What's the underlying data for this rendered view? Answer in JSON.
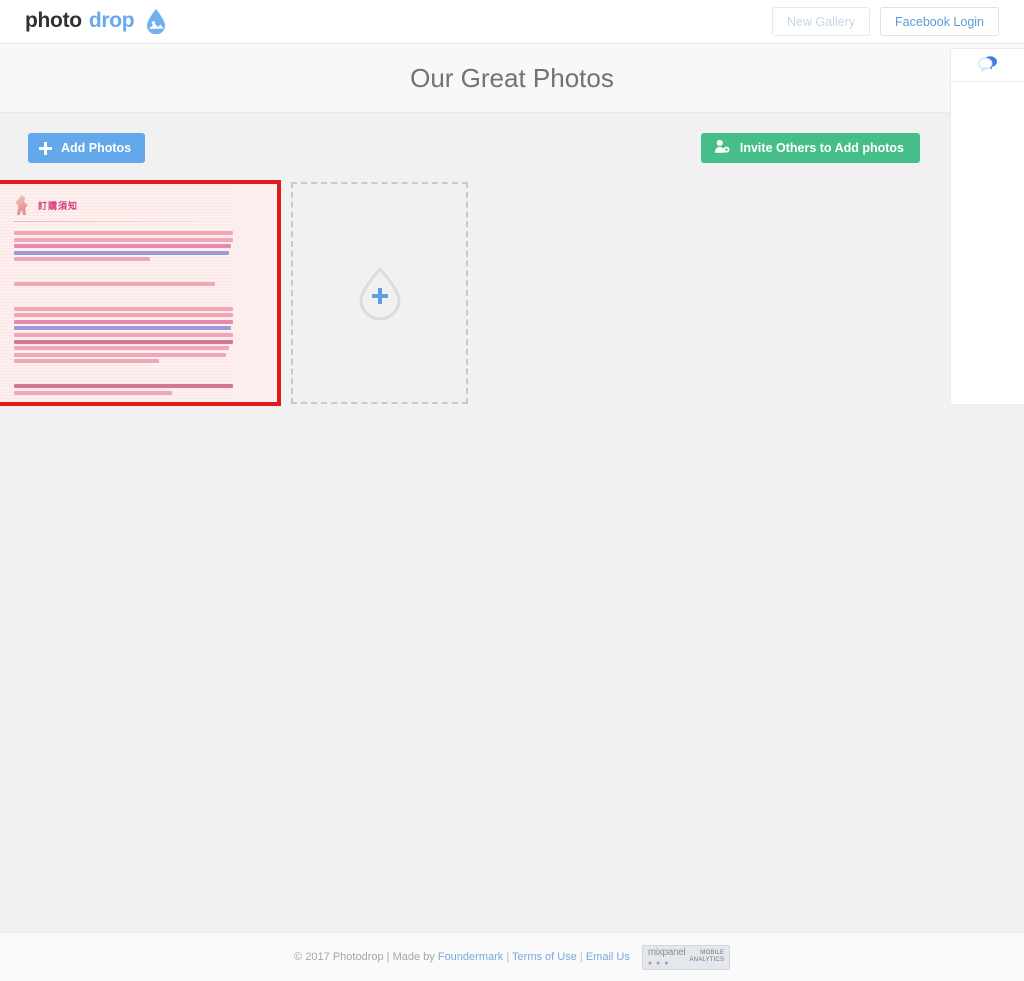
{
  "navbar": {
    "logo": {
      "word1": "photo",
      "word2": "drop",
      "icon": "water-drop-photo-icon"
    },
    "buttons": [
      {
        "label": "New Gallery",
        "name": "new-gallery-button",
        "state": "muted"
      },
      {
        "label": "Facebook Login",
        "name": "facebook-login-button",
        "state": "normal"
      }
    ]
  },
  "header": {
    "gallery_title": "Our Great Photos"
  },
  "actionbar": {
    "add_photos_label": "Add Photos",
    "add_photos_icon": "plus-icon",
    "invite_label": "Invite Others to Add photos",
    "invite_icon": "user-cog-icon"
  },
  "gallery": {
    "photo": {
      "name": "photo-thumbnail-selected",
      "selected": true,
      "doc_title": "訂購須知",
      "alt": "pink printed Chinese ordering-notice document"
    },
    "dropzone": {
      "name": "upload-dropzone",
      "icon": "water-drop-plus-icon"
    }
  },
  "right_panel": {
    "icon": "chat-bubble-icon",
    "name": "chat-panel"
  },
  "footer": {
    "copyright": "© 2017 Photodrop | Made by",
    "links": [
      {
        "label": "Foundermark",
        "name": "footer-link-foundermark"
      },
      {
        "label": "Terms of Use",
        "name": "footer-link-terms"
      },
      {
        "label": "Email Us",
        "name": "footer-link-email"
      }
    ],
    "separator": "|",
    "badge": {
      "name": "mixpanel-badge",
      "brand": "mixpanel",
      "dots": "● ● ●",
      "line1": "MOBILE",
      "line2": "ANALYTICS"
    }
  },
  "colors": {
    "accent_blue": "#62a8ea",
    "accent_green": "#46be8a",
    "selection_red": "#e01b1b",
    "link_blue": "#7aa8dd",
    "page_bg": "#f1f1f1"
  }
}
